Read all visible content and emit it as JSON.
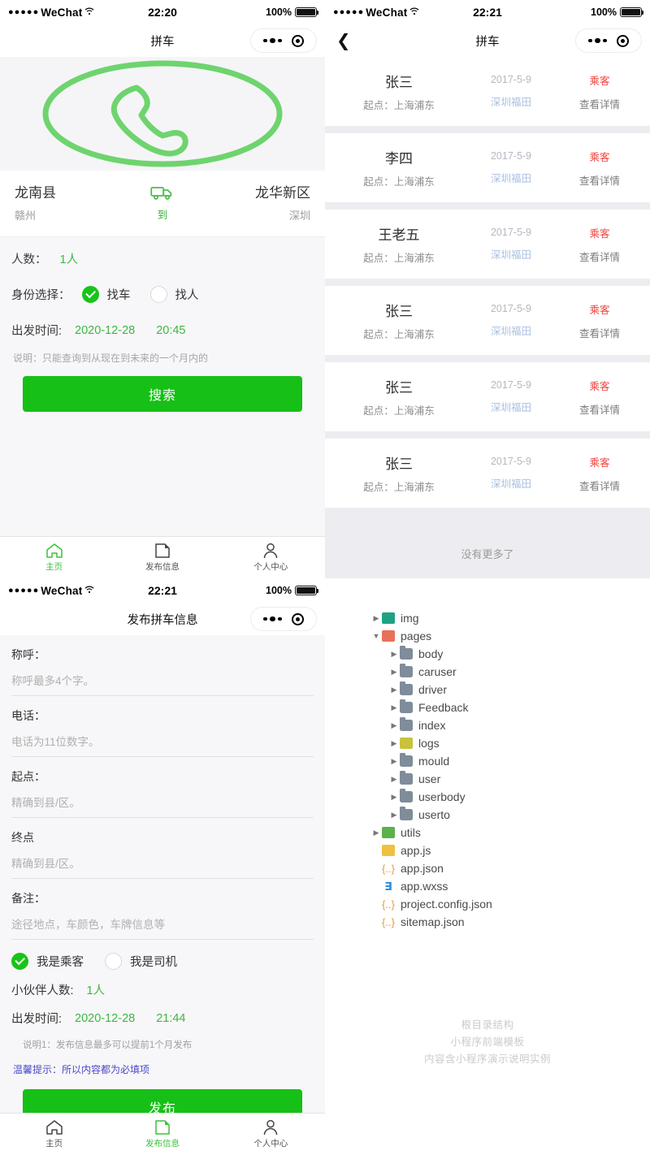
{
  "phone1": {
    "status": {
      "dots": "●●●●●",
      "carrier": "WeChat",
      "wifi": "⊑",
      "time": "22:20",
      "battery_pct": "100%"
    },
    "nav": {
      "title": "拼车"
    },
    "hero_icon": "phone-call-icon",
    "route": {
      "from_city": "龙南县",
      "from_province": "赣州",
      "mid_icon": "truck-icon",
      "mid_label": "到",
      "to_city": "龙华新区",
      "to_province": "深圳"
    },
    "form": {
      "people_label": "人数：",
      "people_value": "1人",
      "identity_label": "身份选择：",
      "option_find_car": "找车",
      "option_find_person": "找人",
      "depart_label": "出发时间:",
      "depart_date": "2020-12-28",
      "depart_time": "20:45",
      "note": "说明：只能查询到从现在到未来的一个月内的",
      "search_button": "搜索"
    },
    "tabbar": [
      {
        "icon": "home-icon",
        "label": "主页",
        "active": true
      },
      {
        "icon": "edit-square-icon",
        "label": "发布信息",
        "active": false
      },
      {
        "icon": "person-icon",
        "label": "个人中心",
        "active": false
      }
    ]
  },
  "phone2": {
    "status": {
      "dots": "●●●●●",
      "carrier": "WeChat",
      "wifi": "⊑",
      "time": "22:21",
      "battery_pct": "100%"
    },
    "nav": {
      "title": "拼车",
      "back_icon": "chevron-left-icon"
    },
    "list": [
      {
        "name": "张三",
        "origin": "起点：上海浦东",
        "date": "2017-5-9",
        "destination": "深圳福田",
        "role": "乘客",
        "detail": "查看详情"
      },
      {
        "name": "李四",
        "origin": "起点：上海浦东",
        "date": "2017-5-9",
        "destination": "深圳福田",
        "role": "乘客",
        "detail": "查看详情"
      },
      {
        "name": "王老五",
        "origin": "起点：上海浦东",
        "date": "2017-5-9",
        "destination": "深圳福田",
        "role": "乘客",
        "detail": "查看详情"
      },
      {
        "name": "张三",
        "origin": "起点：上海浦东",
        "date": "2017-5-9",
        "destination": "深圳福田",
        "role": "乘客",
        "detail": "查看详情"
      },
      {
        "name": "张三",
        "origin": "起点：上海浦东",
        "date": "2017-5-9",
        "destination": "深圳福田",
        "role": "乘客",
        "detail": "查看详情"
      },
      {
        "name": "张三",
        "origin": "起点：上海浦东",
        "date": "2017-5-9",
        "destination": "深圳福田",
        "role": "乘客",
        "detail": "查看详情"
      }
    ],
    "no_more": "没有更多了"
  },
  "phone3": {
    "status": {
      "dots": "●●●●●",
      "carrier": "WeChat",
      "wifi": "⊑",
      "time": "22:21",
      "battery_pct": "100%"
    },
    "nav": {
      "title": "发布拼车信息"
    },
    "fields": [
      {
        "label": "称呼：",
        "placeholder": "称呼最多4个字。"
      },
      {
        "label": "电话：",
        "placeholder": "电话为11位数字。"
      },
      {
        "label": "起点：",
        "placeholder": "精确到县/区。"
      },
      {
        "label": "终点",
        "placeholder": "精确到县/区。"
      },
      {
        "label": "备注：",
        "placeholder": "途径地点，车颜色，车牌信息等"
      }
    ],
    "role_passenger": "我是乘客",
    "role_driver": "我是司机",
    "partner_label": "小伙伴人数:",
    "partner_value": "1人",
    "depart_label": "出发时间:",
    "depart_date": "2020-12-28",
    "depart_time": "21:44",
    "note1": "说明1：发布信息最多可以提前1个月发布",
    "tip": "温馨提示：所以内容都为必填项",
    "publish_button": "发布",
    "tabbar": [
      {
        "icon": "home-icon",
        "label": "主页",
        "active": false
      },
      {
        "icon": "edit-square-icon",
        "label": "发布信息",
        "active": true
      },
      {
        "icon": "person-icon",
        "label": "个人中心",
        "active": false
      }
    ]
  },
  "filetree": {
    "nodes": [
      {
        "name": "img",
        "depth": 0,
        "arrow": "right",
        "icon": "img"
      },
      {
        "name": "pages",
        "depth": 0,
        "arrow": "down",
        "icon": "pages"
      },
      {
        "name": "body",
        "depth": 1,
        "arrow": "right",
        "icon": "folder"
      },
      {
        "name": "caruser",
        "depth": 1,
        "arrow": "right",
        "icon": "folder"
      },
      {
        "name": "driver",
        "depth": 1,
        "arrow": "right",
        "icon": "folder"
      },
      {
        "name": "Feedback",
        "depth": 1,
        "arrow": "right",
        "icon": "folder"
      },
      {
        "name": "index",
        "depth": 1,
        "arrow": "right",
        "icon": "folder"
      },
      {
        "name": "logs",
        "depth": 1,
        "arrow": "right",
        "icon": "logs"
      },
      {
        "name": "mould",
        "depth": 1,
        "arrow": "right",
        "icon": "folder"
      },
      {
        "name": "user",
        "depth": 1,
        "arrow": "right",
        "icon": "folder"
      },
      {
        "name": "userbody",
        "depth": 1,
        "arrow": "right",
        "icon": "folder"
      },
      {
        "name": "userto",
        "depth": 1,
        "arrow": "right",
        "icon": "folder"
      },
      {
        "name": "utils",
        "depth": 0,
        "arrow": "right",
        "icon": "utils"
      },
      {
        "name": "app.js",
        "depth": 0,
        "arrow": "none",
        "icon": "js"
      },
      {
        "name": "app.json",
        "depth": 0,
        "arrow": "none",
        "icon": "json"
      },
      {
        "name": "app.wxss",
        "depth": 0,
        "arrow": "none",
        "icon": "wxss"
      },
      {
        "name": "project.config.json",
        "depth": 0,
        "arrow": "none",
        "icon": "json"
      },
      {
        "name": "sitemap.json",
        "depth": 0,
        "arrow": "none",
        "icon": "json"
      }
    ],
    "watermark": [
      "根目录结构",
      "小程序前端模板",
      "内容含小程序演示说明实例"
    ]
  },
  "colors": {
    "green": "#17c017",
    "red": "#f0443d",
    "blue": "#4a48c8"
  }
}
